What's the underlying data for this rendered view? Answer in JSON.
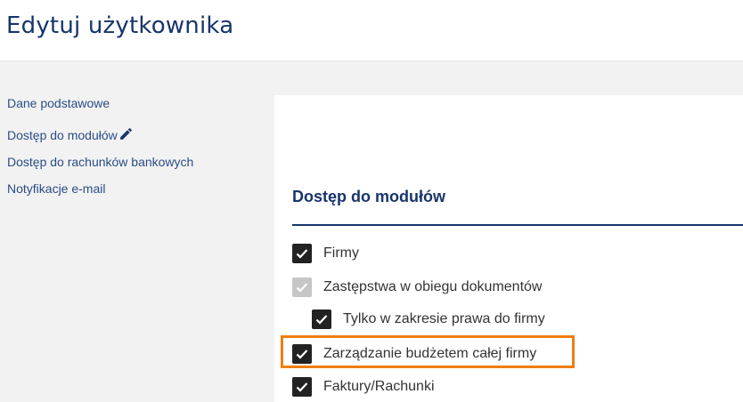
{
  "header": {
    "title": "Edytuj użytkownika"
  },
  "sidebar": {
    "items": [
      {
        "label": "Dane podstawowe"
      },
      {
        "label": "Dostęp do modułów",
        "active_icon": "pencil-icon"
      },
      {
        "label": "Dostęp do rachunków bankowych"
      },
      {
        "label": "Notyfikacje e-mail"
      }
    ]
  },
  "section": {
    "title": "Dostęp do modułów"
  },
  "options": [
    {
      "label": "Firmy",
      "checked": true,
      "disabled": false
    },
    {
      "label": "Zastępstwa w obiegu dokumentów",
      "checked": true,
      "disabled": true
    },
    {
      "label": "Tylko w zakresie prawa do firmy",
      "checked": true,
      "disabled": false
    },
    {
      "label": "Zarządzanie budżetem całej firmy",
      "checked": true,
      "disabled": false,
      "highlighted": true
    },
    {
      "label": "Faktury/Rachunki",
      "checked": true,
      "disabled": false
    }
  ],
  "colors": {
    "accent": "#17356b",
    "link": "#2a4d86",
    "highlight": "#f07d12",
    "checkbox": "#222222",
    "checkbox_disabled": "#c6c6c6"
  }
}
